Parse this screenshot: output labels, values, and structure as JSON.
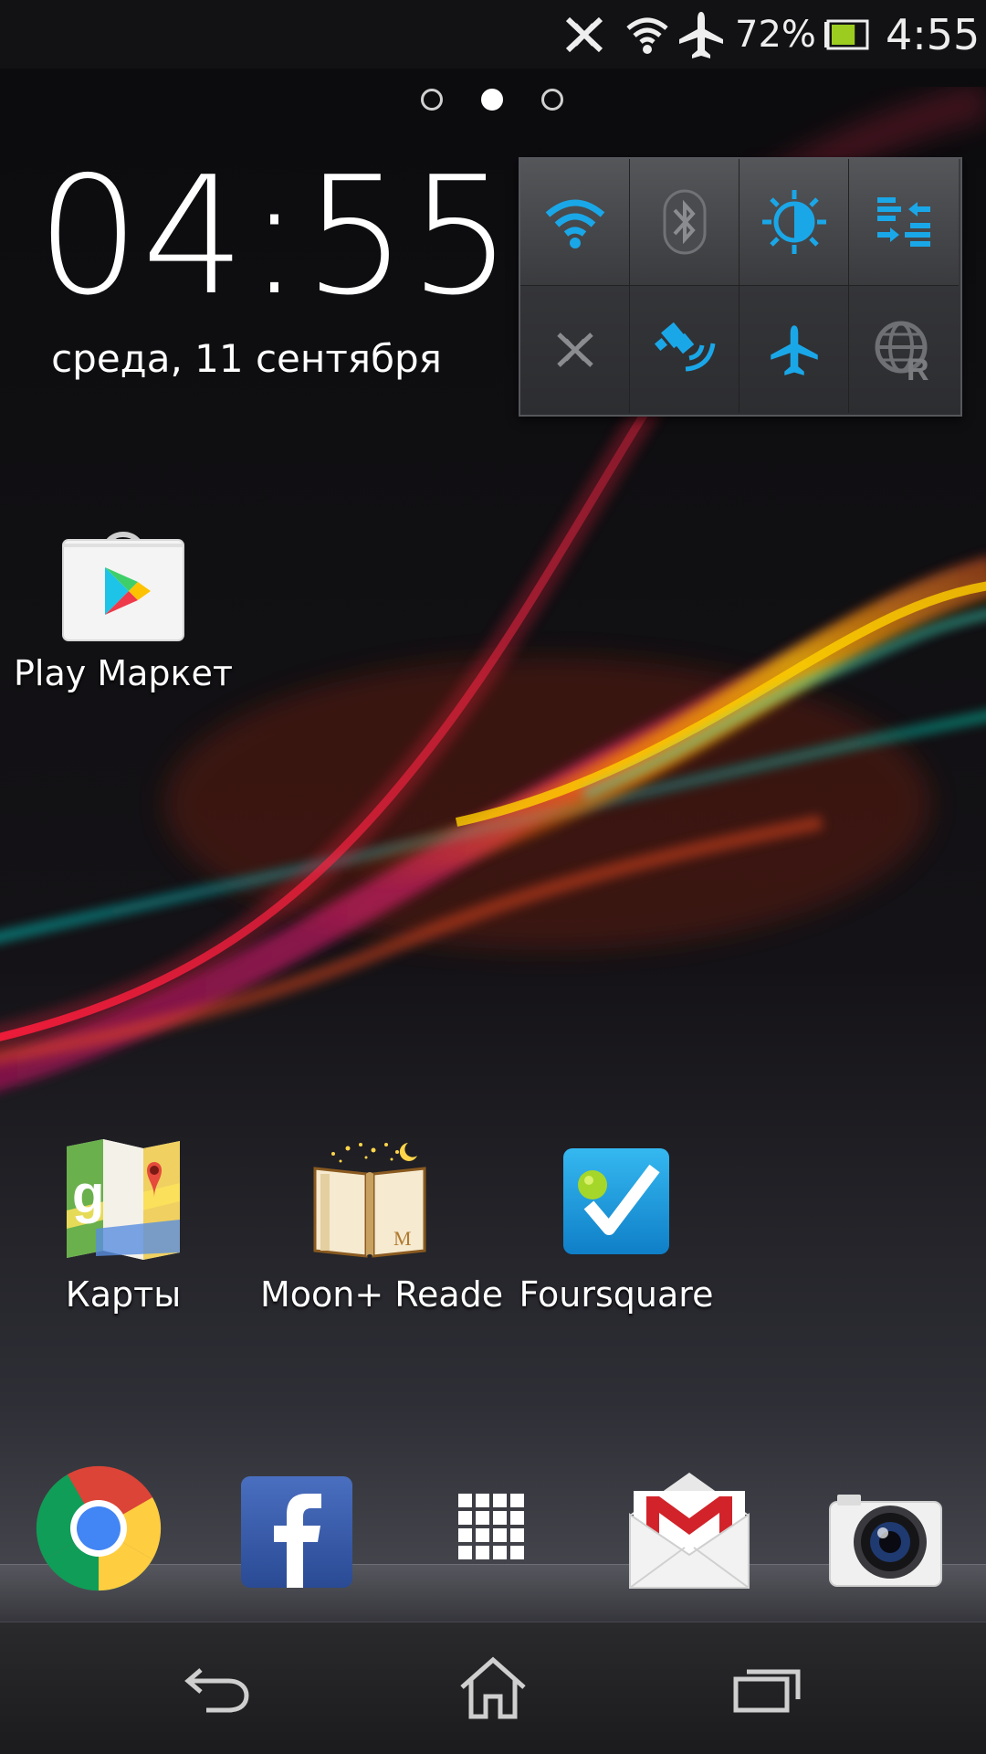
{
  "status_bar": {
    "icons": [
      "nfc-off-icon",
      "wifi-icon",
      "airplane-mode-icon",
      "battery-icon"
    ],
    "battery_percent": "72%",
    "battery_level": 0.72,
    "time": "4:55"
  },
  "home_pages": {
    "count": 3,
    "active_index": 1
  },
  "clock_widget": {
    "time": "04:55",
    "date": "среда, 11 сентября"
  },
  "quick_settings": {
    "accent": "#1aa7e8",
    "inactive": "#8a8c90",
    "toggles": [
      {
        "name": "wifi",
        "icon": "wifi-icon",
        "on": true
      },
      {
        "name": "bluetooth",
        "icon": "bluetooth-icon",
        "on": false
      },
      {
        "name": "brightness",
        "icon": "brightness-icon",
        "on": true
      },
      {
        "name": "data-sync",
        "icon": "data-sync-icon",
        "on": true
      },
      {
        "name": "nfc",
        "icon": "nfc-icon",
        "on": false
      },
      {
        "name": "gps",
        "icon": "gps-icon",
        "on": true
      },
      {
        "name": "airplane-mode",
        "icon": "airplane-mode-icon",
        "on": true
      },
      {
        "name": "data-roaming",
        "icon": "data-roaming-icon",
        "on": false
      }
    ]
  },
  "apps": [
    {
      "label": "Play Маркет",
      "icon": "play-store-icon"
    },
    {
      "label": "Карты",
      "icon": "maps-icon"
    },
    {
      "label": "Moon+ Reade",
      "icon": "moon-reader-icon"
    },
    {
      "label": "Foursquare",
      "icon": "foursquare-icon"
    }
  ],
  "dock": [
    {
      "icon": "chrome-icon"
    },
    {
      "icon": "facebook-icon"
    },
    {
      "icon": "app-drawer-icon"
    },
    {
      "icon": "gmail-icon"
    },
    {
      "icon": "camera-icon"
    }
  ],
  "nav_bar": {
    "buttons": [
      {
        "icon": "back-icon"
      },
      {
        "icon": "home-icon"
      },
      {
        "icon": "recent-apps-icon"
      }
    ]
  }
}
